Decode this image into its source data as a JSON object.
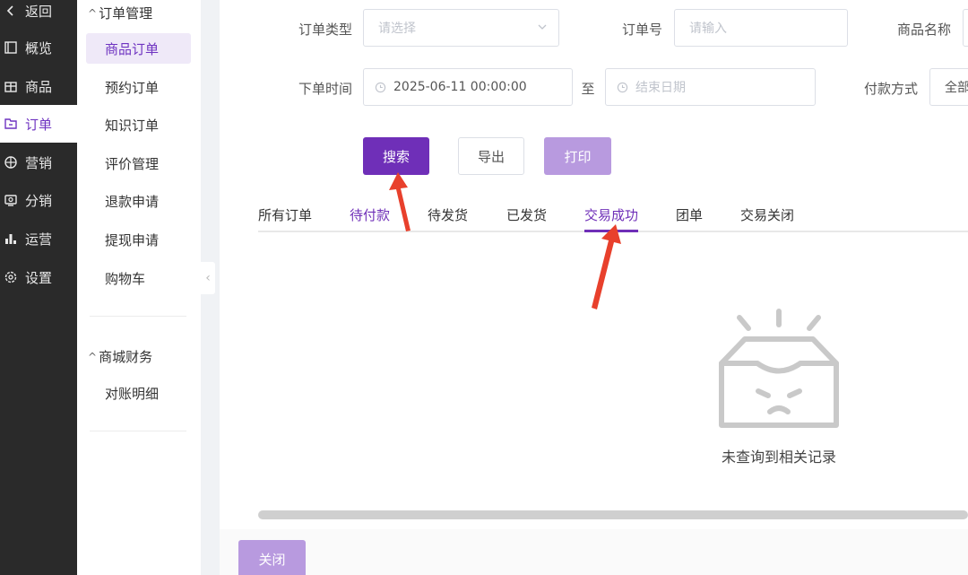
{
  "nav": {
    "items": [
      {
        "label": "返回",
        "icon": "chevron-left-icon"
      },
      {
        "label": "概览",
        "icon": "overview-icon"
      },
      {
        "label": "商品",
        "icon": "goods-icon"
      },
      {
        "label": "订单",
        "icon": "order-icon"
      },
      {
        "label": "营销",
        "icon": "target-icon"
      },
      {
        "label": "分销",
        "icon": "distribution-icon"
      },
      {
        "label": "运营",
        "icon": "bar-chart-icon"
      },
      {
        "label": "设置",
        "icon": "gear-icon"
      }
    ],
    "active": "订单"
  },
  "subnav": {
    "group1": {
      "title": "订单管理",
      "items": [
        "商品订单",
        "预约订单",
        "知识订单",
        "评价管理",
        "退款申请",
        "提现申请",
        "购物车"
      ]
    },
    "group2": {
      "title": "商城财务",
      "items": [
        "对账明细"
      ]
    },
    "active": "商品订单"
  },
  "filters": {
    "order_type": {
      "label": "订单类型",
      "placeholder": "请选择"
    },
    "order_no": {
      "label": "订单号",
      "placeholder": "请输入"
    },
    "product_name": {
      "label": "商品名称"
    },
    "order_time": {
      "label": "下单时间",
      "start": "2025-06-11 00:00:00",
      "separator": "至",
      "end_placeholder": "结束日期"
    },
    "payment": {
      "label": "付款方式",
      "value": "全部"
    }
  },
  "buttons": {
    "search": "搜索",
    "export": "导出",
    "print": "打印",
    "close": "关闭"
  },
  "tabs": [
    "所有订单",
    "待付款",
    "待发货",
    "已发货",
    "交易成功",
    "团单",
    "交易关闭"
  ],
  "active_tab": "交易成功",
  "empty_text": "未查询到相关记录",
  "colors": {
    "primary": "#6f2fb8",
    "primary_light": "#b89adf",
    "sidebar_dark": "#2a2a2a",
    "annotation": "#e8402c"
  }
}
